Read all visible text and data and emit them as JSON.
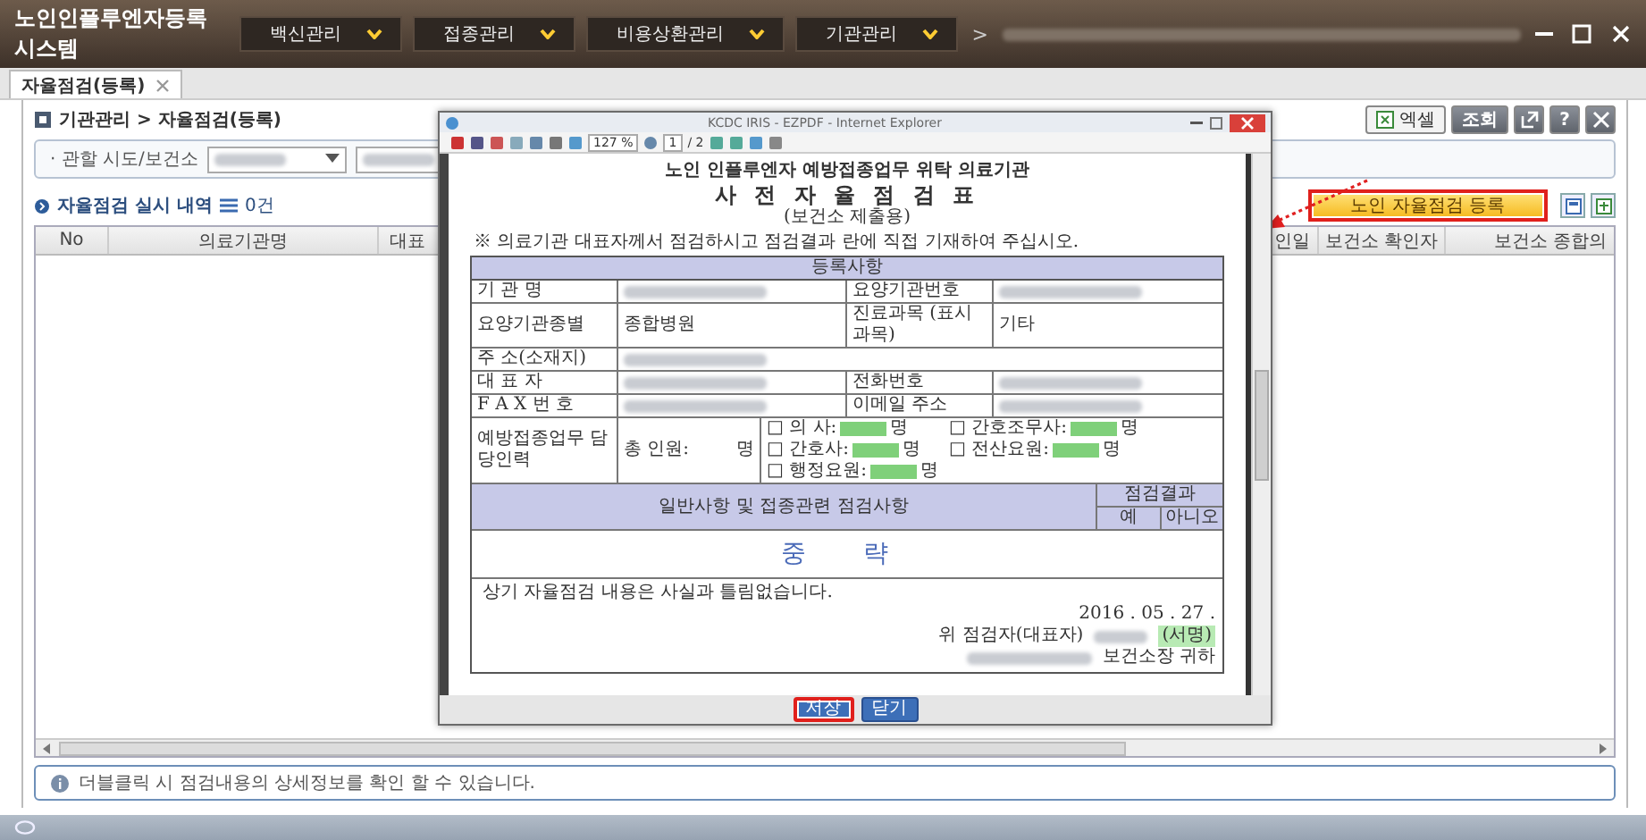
{
  "app": {
    "title": "노인인플루엔자등록 시스템",
    "menus": [
      {
        "label": "백신관리"
      },
      {
        "label": "접종관리"
      },
      {
        "label": "비용상환관리"
      },
      {
        "label": "기관관리"
      }
    ],
    "path_separator": ">"
  },
  "tabs": [
    {
      "label": "자율점검(등록)",
      "selected": true
    }
  ],
  "breadcrumb": "기관관리 > 자율점검(등록)",
  "toolbar_buttons": [
    {
      "kind": "excel",
      "label": "엑셀"
    },
    {
      "kind": "text",
      "label": "조회"
    },
    {
      "kind": "popout"
    },
    {
      "kind": "help",
      "label": "?"
    },
    {
      "kind": "close"
    }
  ],
  "filter": {
    "label": "· 관할 시도/보건소"
  },
  "section": {
    "title": "자율점검 실시 내역",
    "count": "0건"
  },
  "register_button": {
    "label": "노인 자율점검 등록",
    "highlighted": true
  },
  "table": {
    "columns": [
      "No",
      "의료기관명",
      "대표",
      "인일",
      "보건소 확인자",
      "보건소 종합의"
    ]
  },
  "info": "더블클릭 시 점검내용의 상세정보를 확인 할 수 있습니다.",
  "popup": {
    "title": "KCDC IRIS - EZPDF - Internet Explorer",
    "zoom": "127 %",
    "page": "1",
    "pages": "/ 2",
    "form": {
      "heading": [
        "노인 인플루엔자 예방접종업무 위탁 의료기관",
        "사 전 자 율 점 검 표",
        "(보건소 제출용)"
      ],
      "note": "※ 의료기관 대표자께서 점검하시고 점검결과 란에 직접 기재하여 주십시오.",
      "section": "등록사항",
      "rows": [
        [
          {
            "kind": "label",
            "text": "기 관 명"
          },
          {
            "kind": "redacted"
          },
          {
            "kind": "label",
            "text": "요양기관번호"
          },
          {
            "kind": "redacted"
          }
        ],
        [
          {
            "kind": "label",
            "text": "요양기관종별"
          },
          {
            "kind": "value",
            "text": "종합병원"
          },
          {
            "kind": "label",
            "text": "진료과목 (표시과목)"
          },
          {
            "kind": "value",
            "text": "기타"
          }
        ],
        [
          {
            "kind": "label",
            "text": "주 소(소재지)"
          },
          {
            "kind": "redacted_wide"
          }
        ],
        [
          {
            "kind": "label",
            "text": "대 표 자"
          },
          {
            "kind": "redacted"
          },
          {
            "kind": "label",
            "text": "전화번호"
          },
          {
            "kind": "redacted"
          }
        ],
        [
          {
            "kind": "label",
            "text": "F A X 번 호"
          },
          {
            "kind": "redacted"
          },
          {
            "kind": "label",
            "text": "이메일 주소"
          },
          {
            "kind": "redacted"
          }
        ]
      ],
      "staff": {
        "label": "예방접종업무 담당인력",
        "total": "총 인원:",
        "total_unit": "명",
        "roles_left": [
          {
            "label": "□ 의 사:",
            "unit": "명"
          },
          {
            "label": "□ 간호사:",
            "unit": "명"
          },
          {
            "label": "□ 행정요원:",
            "unit": "명"
          }
        ],
        "roles_right": [
          {
            "label": "□ 간호조무사:",
            "unit": "명"
          },
          {
            "label": "□ 전산요원:",
            "unit": "명"
          }
        ]
      },
      "checks": {
        "title": "일반사항 및 접종관련 점검사항",
        "result": "점검결과",
        "yes": "예",
        "no": "아니오"
      },
      "omitted": "중 략",
      "statement": "상기 자율점검 내용은 사실과 틀림없습니다.",
      "date": "2016 . 05 . 27 .",
      "signer": "위 점검자(대표자)",
      "signature": "(서명)",
      "addressee": "보건소장 귀하"
    },
    "buttons": [
      {
        "label": "저장",
        "highlighted": true
      },
      {
        "label": "닫기",
        "highlighted": false
      }
    ]
  }
}
